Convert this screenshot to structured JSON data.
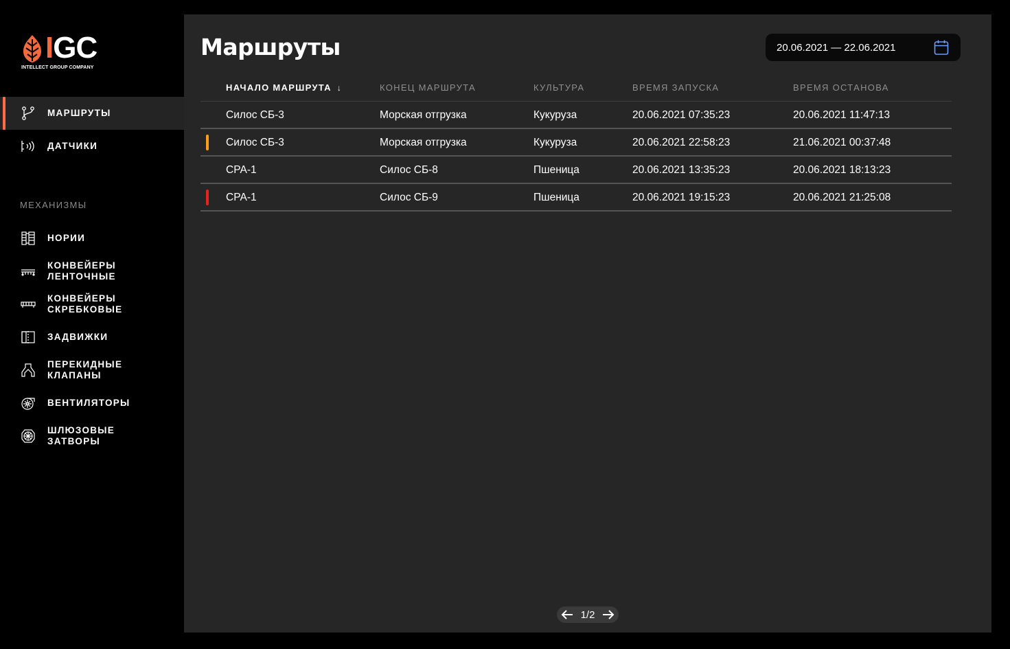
{
  "logo": {
    "brand_i": "I",
    "brand_gc": "GC",
    "subtitle": "INTELLECT GROUP COMPANY"
  },
  "nav": {
    "routes": {
      "label": "Маршруты",
      "icon": "route-icon"
    },
    "sensors": {
      "label": "Датчики",
      "icon": "sensor-icon"
    }
  },
  "mechanisms": {
    "title": "Механизмы",
    "items": [
      {
        "label": "Нории",
        "icon": "bucket-elevator-icon"
      },
      {
        "label_1": "Конвейеры",
        "label_2": "ленточные",
        "icon": "belt-conveyor-icon"
      },
      {
        "label_1": "Конвейеры",
        "label_2": "скребковые",
        "icon": "scraper-conveyor-icon"
      },
      {
        "label": "Задвижки",
        "icon": "gate-valve-icon"
      },
      {
        "label_1": "Перекидные",
        "label_2": "клапаны",
        "icon": "diverter-valve-icon"
      },
      {
        "label": "Вентиляторы",
        "icon": "fan-icon"
      },
      {
        "label_1": "Шлюзовые",
        "label_2": "затворы",
        "icon": "rotary-valve-icon"
      }
    ]
  },
  "main": {
    "title": "Маршруты",
    "date_range": "20.06.2021 — 22.06.2021",
    "columns": [
      "Начало маршрута",
      "Конец маршрута",
      "Культура",
      "Время запуска",
      "Время останова"
    ],
    "sort_arrow": "↓",
    "rows": [
      {
        "start": "Силос СБ-3",
        "end": "Морская отгрузка",
        "crop": "Кукуруза",
        "launch": "20.06.2021 07:35:23",
        "stop": "20.06.2021 11:47:13",
        "status_color": ""
      },
      {
        "start": "Силос СБ-3",
        "end": "Морская отгрузка",
        "crop": "Кукуруза",
        "launch": "20.06.2021 22:58:23",
        "stop": "21.06.2021 00:37:48",
        "status_color": "#ff9d1a"
      },
      {
        "start": "СРА-1",
        "end": "Силос СБ-8",
        "crop": "Пшеница",
        "launch": "20.06.2021 13:35:23",
        "stop": "20.06.2021 18:13:23",
        "status_color": ""
      },
      {
        "start": "СРА-1",
        "end": "Силос СБ-9",
        "crop": "Пшеница",
        "launch": "20.06.2021 19:15:23",
        "stop": "20.06.2021 21:25:08",
        "status_color": "#e8231f"
      }
    ],
    "pager": "1/2"
  },
  "colors": {
    "accent": "#ff6b47",
    "warning": "#ff9d1a",
    "error": "#e8231f",
    "calendar": "#6b9bff"
  }
}
